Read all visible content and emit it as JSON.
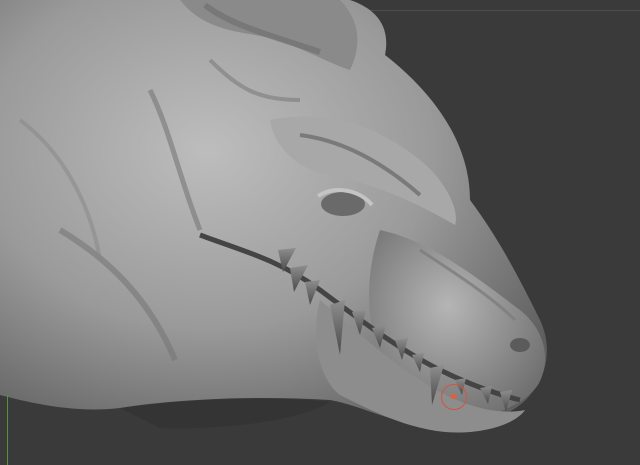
{
  "viewport": {
    "background_color": "#3a3a3a",
    "model_color": "#9c9c9c",
    "cursor_color": "#d2553f",
    "axis_color": "#5a8f3e"
  },
  "icons": {
    "brush_cursor": "circle-crosshair-icon"
  }
}
